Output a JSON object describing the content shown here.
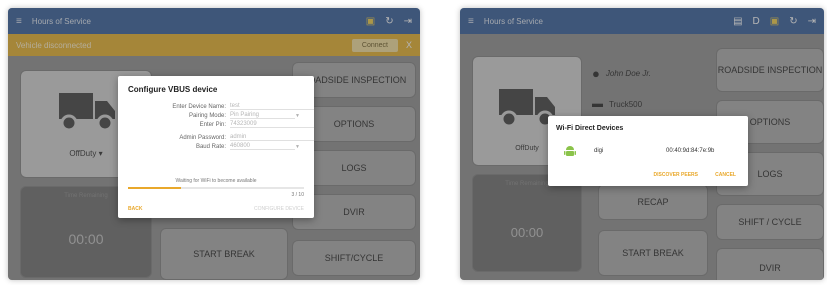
{
  "left": {
    "appbar": {
      "title": "Hours of Service"
    },
    "banner": {
      "text": "Vehicle disconnected",
      "connect_label": "Connect",
      "close_label": "X"
    },
    "status": {
      "duty_label": "OffDuty"
    },
    "time_card": {
      "label": "Time Remaining",
      "value": "00:00"
    },
    "buttons": {
      "roadside": "ROADSIDE INSPECTION",
      "options": "OPTIONS",
      "logs": "LOGS",
      "dvir": "DVIR",
      "shift": "SHIFT/CYCLE",
      "start_break": "START BREAK"
    },
    "dialog": {
      "title": "Configure VBUS device",
      "fields": [
        {
          "label": "Enter Device Name:",
          "value": "test"
        },
        {
          "label": "Pairing Mode:",
          "value": "Pin Pairing"
        },
        {
          "label": "Enter Pin:",
          "value": "74323009"
        },
        {
          "label": "Admin Password:",
          "value": "admin"
        },
        {
          "label": "Baud Rate:",
          "value": "460800"
        }
      ],
      "status": "Waiting for WiFi to become available",
      "progress_text": "3 / 10",
      "progress": 0.3,
      "back_label": "BACK",
      "next_label": "CONFIGURE DEVICE"
    }
  },
  "right": {
    "appbar": {
      "title": "Hours of Service"
    },
    "driver": {
      "name": "John Doe Jr.",
      "vehicle": "Truck500"
    },
    "status": {
      "duty_label": "OffDuty"
    },
    "time_card": {
      "label": "Time Remaining",
      "value": "00:00"
    },
    "buttons": {
      "roadside": "ROADSIDE INSPECTION",
      "options": "OPTIONS",
      "logs": "LOGS",
      "recap": "RECAP",
      "shift": "SHIFT / CYCLE",
      "start_break": "START BREAK",
      "dvir": "DVIR"
    },
    "dialog": {
      "title": "Wi-Fi Direct Devices",
      "device_name": "digi",
      "device_mac": "00:40:9d:84:7e:9b",
      "discover_label": "DISCOVER PEERS",
      "cancel_label": "CANCEL"
    }
  },
  "colors": {
    "appbar": "#4a6fa5",
    "banner": "#e9b943",
    "accent": "#e9a82b",
    "android_green": "#8bc34a"
  }
}
